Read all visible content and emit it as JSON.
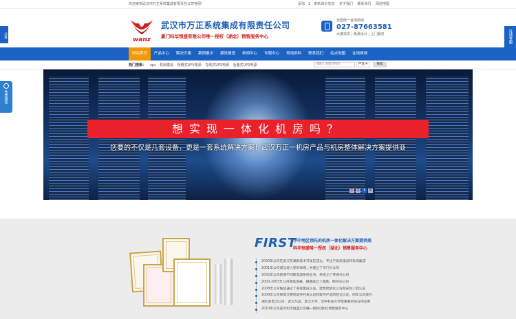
{
  "topbar": {
    "welcome": "欢迎来到武汉市万正系统集成有限责任公司官网！",
    "links": [
      {
        "label": "添加",
        "highlight": false
      },
      {
        "label": "2",
        "highlight": true
      },
      {
        "label": "条新询价信息",
        "highlight": false
      },
      {
        "label": "关于我们",
        "highlight": false
      },
      {
        "label": "联系我们",
        "highlight": false
      },
      {
        "label": "网站地图",
        "highlight": false
      }
    ]
  },
  "header": {
    "logo_text": "wanz",
    "company_name": "武汉市万正系统集成有限责任公司",
    "company_sub": "厦门科华恒盛有限公司唯一授权（湖北）销售服务中心",
    "hotline_label": "全国统一咨询热线",
    "hotline_number": "027-87663581",
    "hotline_service": "大量现货 | 免费设计 | 上门服务"
  },
  "nav": {
    "items": [
      {
        "label": "网站首页",
        "active": true
      },
      {
        "label": "产品中心",
        "active": false
      },
      {
        "label": "解决方案",
        "active": false
      },
      {
        "label": "案例展示",
        "active": false
      },
      {
        "label": "媒体报道",
        "active": false
      },
      {
        "label": "新闻中心",
        "active": false
      },
      {
        "label": "专题中心",
        "active": false
      },
      {
        "label": "常用资料",
        "active": false
      },
      {
        "label": "联系我们",
        "active": false
      },
      {
        "label": "站点地图",
        "active": false
      },
      {
        "label": "在线商城",
        "active": false
      }
    ]
  },
  "subbar": {
    "hot_label": "热门搜索：",
    "keywords": [
      "ups",
      "机房建设",
      "柜機式UPS电源",
      "在线式UPS电源",
      "后备式UPS电源"
    ],
    "search_placeholder": "请输入关键词搜索",
    "search_select": "产品",
    "search_button": "搜索"
  },
  "banner": {
    "headline": "想实现一体化机房吗？",
    "tagline": "您要的不仅是几套设备，更是一套系统解决方案！武汉万正一机房产品与机房整体解决方案提供商",
    "dots": [
      {
        "label": "1",
        "active": false
      },
      {
        "label": "2",
        "active": false
      },
      {
        "label": "3",
        "active": true
      },
      {
        "label": "4",
        "active": false
      }
    ]
  },
  "side": {
    "share": "分享",
    "free_consult": "免费通话",
    "online": "在线客服"
  },
  "about": {
    "first": "FIRST",
    "line1": "华中地区领先的机房一体化解决方案提供商",
    "line2": "科华恒盛唯一授权（湖北）销售服务中心",
    "timeline": [
      "2000年公司在武汉东湖新技术开发区成立，专注于机房建设和系统集成",
      "2001年公司成功进入安防领域，并成立了天门分公司",
      "2002年公司新增不间断电源系统业务，并成立了孝感分公司",
      "2003-2005年公司继续发展，相继成立了恩施、荆州分公司",
      "2008年公司陆续通过了系统集成认证、建筑智能化认证和安防工程认证",
      "2009年公司获得计算机软件开发认证和软件产品的登记认证，同年公司成为",
      "湖北省电力公司、武汉凡品、武汉大学、华中科技大学等重要的协议供应商",
      "2010年公司成为科华恒盛公司唯一授权(湖北)销售服务中心"
    ]
  },
  "colors": {
    "brand_blue": "#1a62c4",
    "nav_active": "#f39800",
    "brand_red": "#d21e1e",
    "banner_red": "#e8212b"
  }
}
